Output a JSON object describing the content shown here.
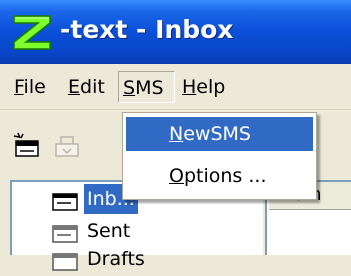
{
  "window": {
    "title": "-text - Inbox",
    "logo_icon": "z-logo-icon"
  },
  "menubar": {
    "items": [
      {
        "label_prefix": "",
        "label_mnemonic": "F",
        "label_rest": "ile"
      },
      {
        "label_prefix": "",
        "label_mnemonic": "E",
        "label_rest": "dit"
      },
      {
        "label_prefix": "",
        "label_mnemonic": "S",
        "label_rest": "MS"
      },
      {
        "label_prefix": "",
        "label_mnemonic": "H",
        "label_rest": "elp"
      }
    ],
    "open_menu": "SMS"
  },
  "toolbar": {
    "buttons": [
      {
        "icon": "new-message-icon",
        "enabled": true
      },
      {
        "icon": "inbox-tray-icon",
        "enabled": false
      }
    ]
  },
  "sms_menu": {
    "items": [
      {
        "label_prefix": "",
        "label_mnemonic": "N",
        "label_rest": "ewSMS",
        "highlighted": true
      },
      {
        "label_prefix": "",
        "label_mnemonic": "O",
        "label_rest": "ptions ...",
        "highlighted": false
      }
    ]
  },
  "folders": {
    "items": [
      {
        "label": "Inbox",
        "visible_text": "Inb...",
        "icon": "folder-card-icon",
        "selected": true
      },
      {
        "label": "Sent",
        "icon": "folder-card-icon",
        "selected": false
      },
      {
        "label": "Drafts",
        "visible_text": "Drafts",
        "icon": "folder-card-icon",
        "selected": false
      }
    ]
  },
  "message_list": {
    "column_header": "From"
  },
  "colors": {
    "titlebar": "#0a4fd8",
    "selection": "#316ac5",
    "window_bg": "#ece9d8"
  }
}
